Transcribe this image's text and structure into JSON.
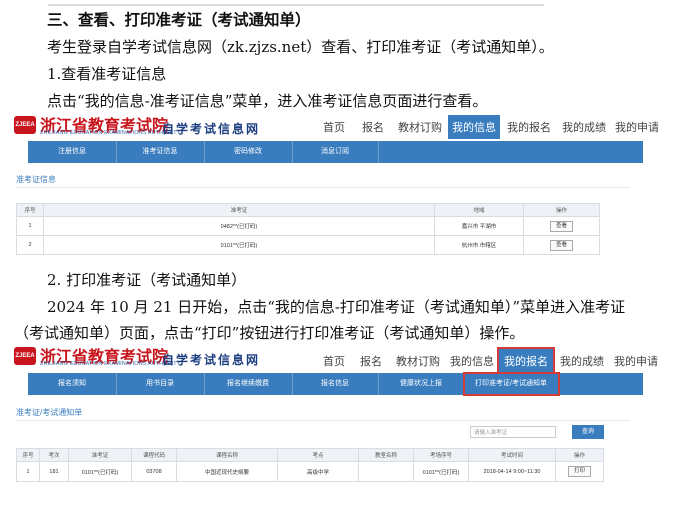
{
  "doc": {
    "heading": "三、查看、打印准考证（考试通知单）",
    "intro": "考生登录自学考试信息网（zk.zjzs.net）查看、打印准考证（考试通知单）。",
    "step1_title": "1.查看准考证信息",
    "step1_text": "点击“我的信息-准考证信息”菜单，进入准考证信息页面进行查看。",
    "step2_title": "2. 打印准考证（考试通知单）",
    "step2_text_a": "2024 年 10 月 21 日开始，点击“我的信息-打印准考证（考试通知单）”菜单进入准考证",
    "step2_text_b": "（考试通知单）页面，点击“打印”按钮进行打印准考证（考试通知单）操作。"
  },
  "brand": {
    "mark": "ZJEEA",
    "name_cn": "浙江省教育考试院",
    "name_en": "ZHEJIANG EDUCATION EXAMINATIONS AUTHORITY",
    "site_title": "自学考试信息网",
    "color": "#c8151d",
    "accent": "#3a7dbf"
  },
  "nav": [
    "首页",
    "报名",
    "教材订购",
    "我的信息",
    "我的报名",
    "我的成绩",
    "我的申请"
  ],
  "shot1": {
    "subnav": [
      "注册信息",
      "准考证信息",
      "密码修改",
      "消息订阅"
    ],
    "section_title": "准考证信息",
    "headers": [
      "序号",
      "准考证",
      "地域",
      "操作"
    ],
    "rows": [
      [
        "1",
        "0482**(已打码)",
        "嘉兴市 平湖市",
        "查看"
      ],
      [
        "2",
        "0101**(已打码)",
        "杭州市 市辖区",
        "查看"
      ]
    ]
  },
  "shot2": {
    "subnav": [
      "报名须知",
      "用书目录",
      "报名继续缴费",
      "报名信息",
      "健康状况上报",
      "打印准考证/考试通知单"
    ],
    "section_title": "准考证/考试通知单",
    "search_placeholder": "请输入准考证",
    "search_button": "查询",
    "headers": [
      "序号",
      "考次",
      "准考证",
      "课程代码",
      "课程名称",
      "考点",
      "教室名称",
      "考场序号",
      "考试时间",
      "操作"
    ],
    "rows": [
      [
        "1",
        "181",
        "0101**(已打码)",
        "03708",
        "中国近现代史纲要",
        "高级中学",
        "",
        "0101**(已打码)",
        "2018-04-14 9:00~11:30",
        "打印"
      ]
    ]
  }
}
